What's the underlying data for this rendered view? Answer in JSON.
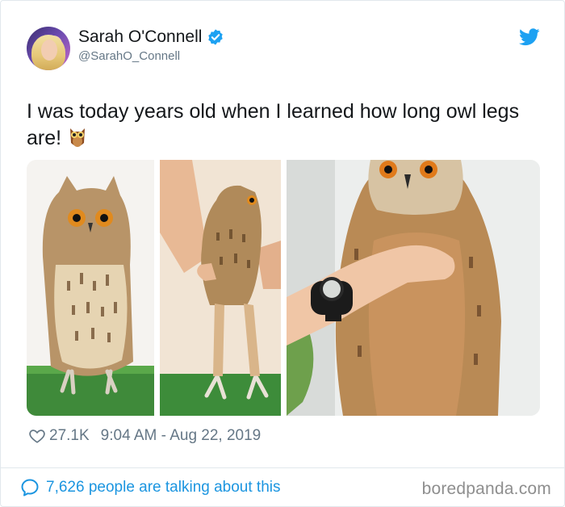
{
  "author": {
    "display_name": "Sarah O'Connell",
    "handle": "@SarahO_Connell",
    "verified": true
  },
  "tweet": {
    "text": "I was today years old when I learned how long owl legs are!",
    "emoji": "owl-emoji",
    "photos": [
      "owl-standing-photo",
      "owl-held-legs-photo",
      "owl-held-wrist-watch-photo"
    ]
  },
  "meta": {
    "likes": "27.1K",
    "timestamp": "9:04 AM - Aug 22, 2019"
  },
  "footer": {
    "talking": "7,626 people are talking about this",
    "watermark": "boredpanda.com"
  },
  "colors": {
    "twitter_blue": "#1da1f2",
    "link_blue": "#1b95e0",
    "secondary_text": "#657786",
    "border": "#e1e8ed"
  }
}
